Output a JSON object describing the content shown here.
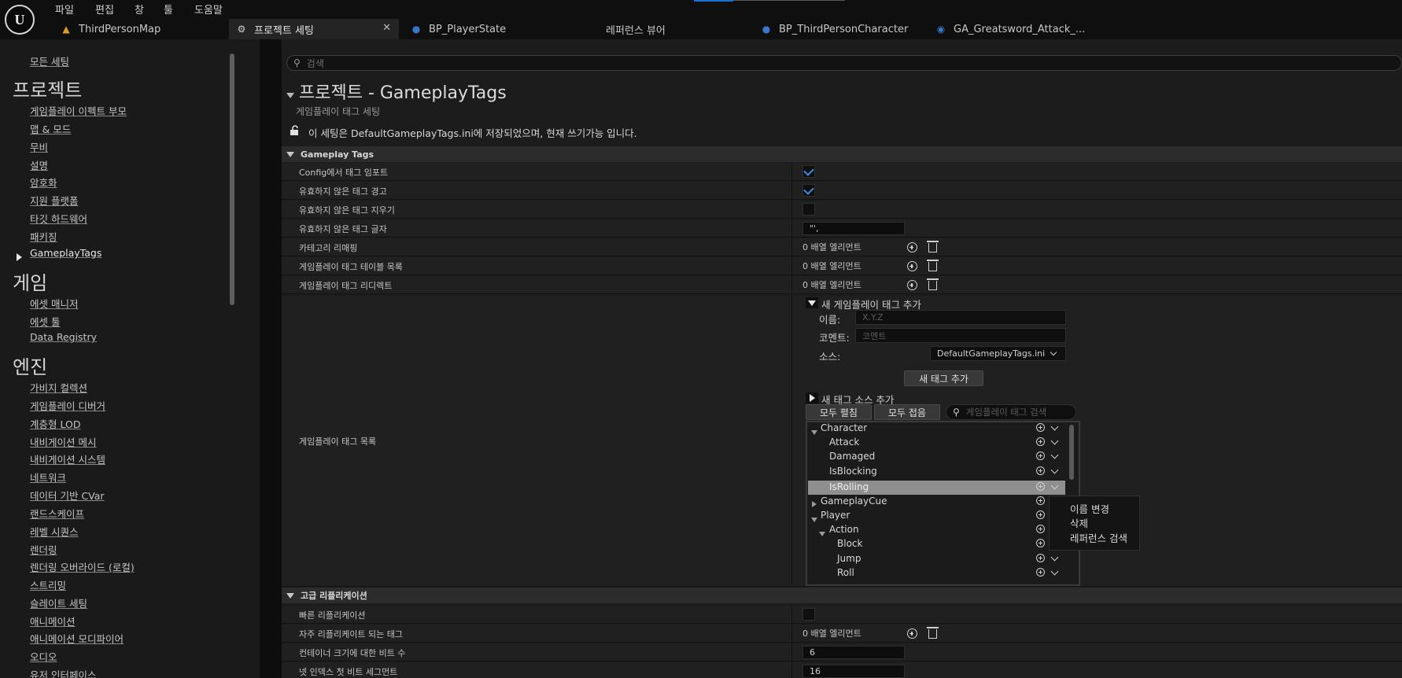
{
  "menubar": {
    "items": [
      "파일",
      "편집",
      "창",
      "툴",
      "도움말"
    ]
  },
  "tabs": [
    {
      "label": "ThirdPersonMap",
      "icon": "level-icon"
    },
    {
      "label": "프로젝트 세팅",
      "icon": "settings-icon",
      "active": true
    },
    {
      "label": "BP_PlayerState",
      "icon": "blueprint-icon"
    },
    {
      "label": "레퍼런스 뷰어",
      "icon": "none"
    },
    {
      "label": "BP_ThirdPersonCharacter",
      "icon": "blueprint-icon"
    },
    {
      "label": "GA_Greatsword_Attack_...",
      "icon": "ability-icon"
    }
  ],
  "sidebar": {
    "all_settings": "모든 세팅",
    "sections": [
      {
        "title": "프로젝트",
        "items": [
          "게임플레이 이펙트 부모",
          "맵 & 모드",
          "무비",
          "설명",
          "암호화",
          "지원 플랫폼",
          "타깃 하드웨어",
          "패키징",
          "GameplayTags"
        ]
      },
      {
        "title": "게임",
        "items": [
          "에셋 매니저",
          "에셋 툴",
          "Data Registry"
        ]
      },
      {
        "title": "엔진",
        "items": [
          "가비지 컬렉션",
          "게임플레이 디버거",
          "계층형 LOD",
          "내비게이션 메시",
          "내비게이션 시스템",
          "네트워크",
          "데이터 기반 CVar",
          "랜드스케이프",
          "레벨 시퀀스",
          "렌더링",
          "렌더링 오버라이드 (로컬)",
          "스트리밍",
          "슬레이트 세팅",
          "애니메이션",
          "애니메이션 모디파이어",
          "오디오",
          "유저 인터페이스"
        ]
      }
    ]
  },
  "search": {
    "placeholder": "검색"
  },
  "page": {
    "title": "프로젝트 - GameplayTags",
    "subtitle": "게임플레이 태그 세팅",
    "notice": "이 세팅은 DefaultGameplayTags.ini에 저장되었으며, 현재 쓰기가능 입니다."
  },
  "gameplay_tags_section": {
    "header": "Gameplay Tags",
    "rows": [
      {
        "label": "Config에서 태그 임포트",
        "type": "check",
        "checked": true
      },
      {
        "label": "유효하지 않은 태그 경고",
        "type": "check",
        "checked": true
      },
      {
        "label": "유효하지 않은 태그 지우기",
        "type": "check",
        "checked": false
      },
      {
        "label": "유효하지 않은 태그 글자",
        "type": "text",
        "value": "\"',"
      },
      {
        "label": "카테고리 리매핑",
        "type": "array",
        "value": "0 배열 엘리먼트"
      },
      {
        "label": "게임플레이 태그 테이블 목록",
        "type": "array",
        "value": "0 배열 엘리먼트"
      },
      {
        "label": "게임플레이 태그 리디렉트",
        "type": "array",
        "value": "0 배열 엘리먼트"
      }
    ],
    "tag_list": {
      "label": "게임플레이 태그 목록",
      "add_new_tag": "새 게임플레이 태그 추가",
      "name_label": "이름:",
      "name_placeholder": "X.Y.Z",
      "comment_label": "코멘트:",
      "comment_placeholder": "코멘트",
      "source_label": "소스:",
      "source_value": "DefaultGameplayTags.ini",
      "add_button": "새 태그 추가",
      "add_source": "새 태그 소스 추가",
      "expand_all": "모두 펼침",
      "collapse_all": "모두 접음",
      "tag_search_placeholder": "게임플레이 태그 검색",
      "tree": [
        {
          "label": "Character",
          "depth": 0,
          "expander": "open",
          "dropdown": true
        },
        {
          "label": "Attack",
          "depth": 1,
          "expander": "none",
          "dropdown": true
        },
        {
          "label": "Damaged",
          "depth": 1,
          "expander": "none",
          "dropdown": true
        },
        {
          "label": "IsBlocking",
          "depth": 1,
          "expander": "none",
          "dropdown": true
        },
        {
          "label": "IsRolling",
          "depth": 1,
          "expander": "none",
          "dropdown": true,
          "selected": true
        },
        {
          "label": "GameplayCue",
          "depth": 0,
          "expander": "closed",
          "dropdown": false
        },
        {
          "label": "Player",
          "depth": 0,
          "expander": "open",
          "dropdown": false
        },
        {
          "label": "Action",
          "depth": 1,
          "expander": "open",
          "dropdown": false
        },
        {
          "label": "Block",
          "depth": 2,
          "expander": "none",
          "dropdown": false
        },
        {
          "label": "Jump",
          "depth": 2,
          "expander": "none",
          "dropdown": true
        },
        {
          "label": "Roll",
          "depth": 2,
          "expander": "none",
          "dropdown": true
        }
      ]
    }
  },
  "context_menu": {
    "items": [
      "이름 변경",
      "삭제",
      "레퍼런스 검색"
    ]
  },
  "replication_section": {
    "header": "고급 리플리케이션",
    "rows": [
      {
        "label": "빠른 리플리케이션",
        "type": "check",
        "checked": false
      },
      {
        "label": "자주 리플리케이트 되는 태그",
        "type": "array",
        "value": "0 배열 엘리먼트"
      },
      {
        "label": "컨테이너 크기에 대한 비트 수",
        "type": "text",
        "value": "6"
      },
      {
        "label": "넷 인덱스 첫 비트 세그먼트",
        "type": "text",
        "value": "16"
      }
    ]
  },
  "colors": {
    "background": "#151515",
    "panel": "#1c1c1c",
    "accent": "#3a8ee8",
    "selection": "#8f8f8f"
  }
}
